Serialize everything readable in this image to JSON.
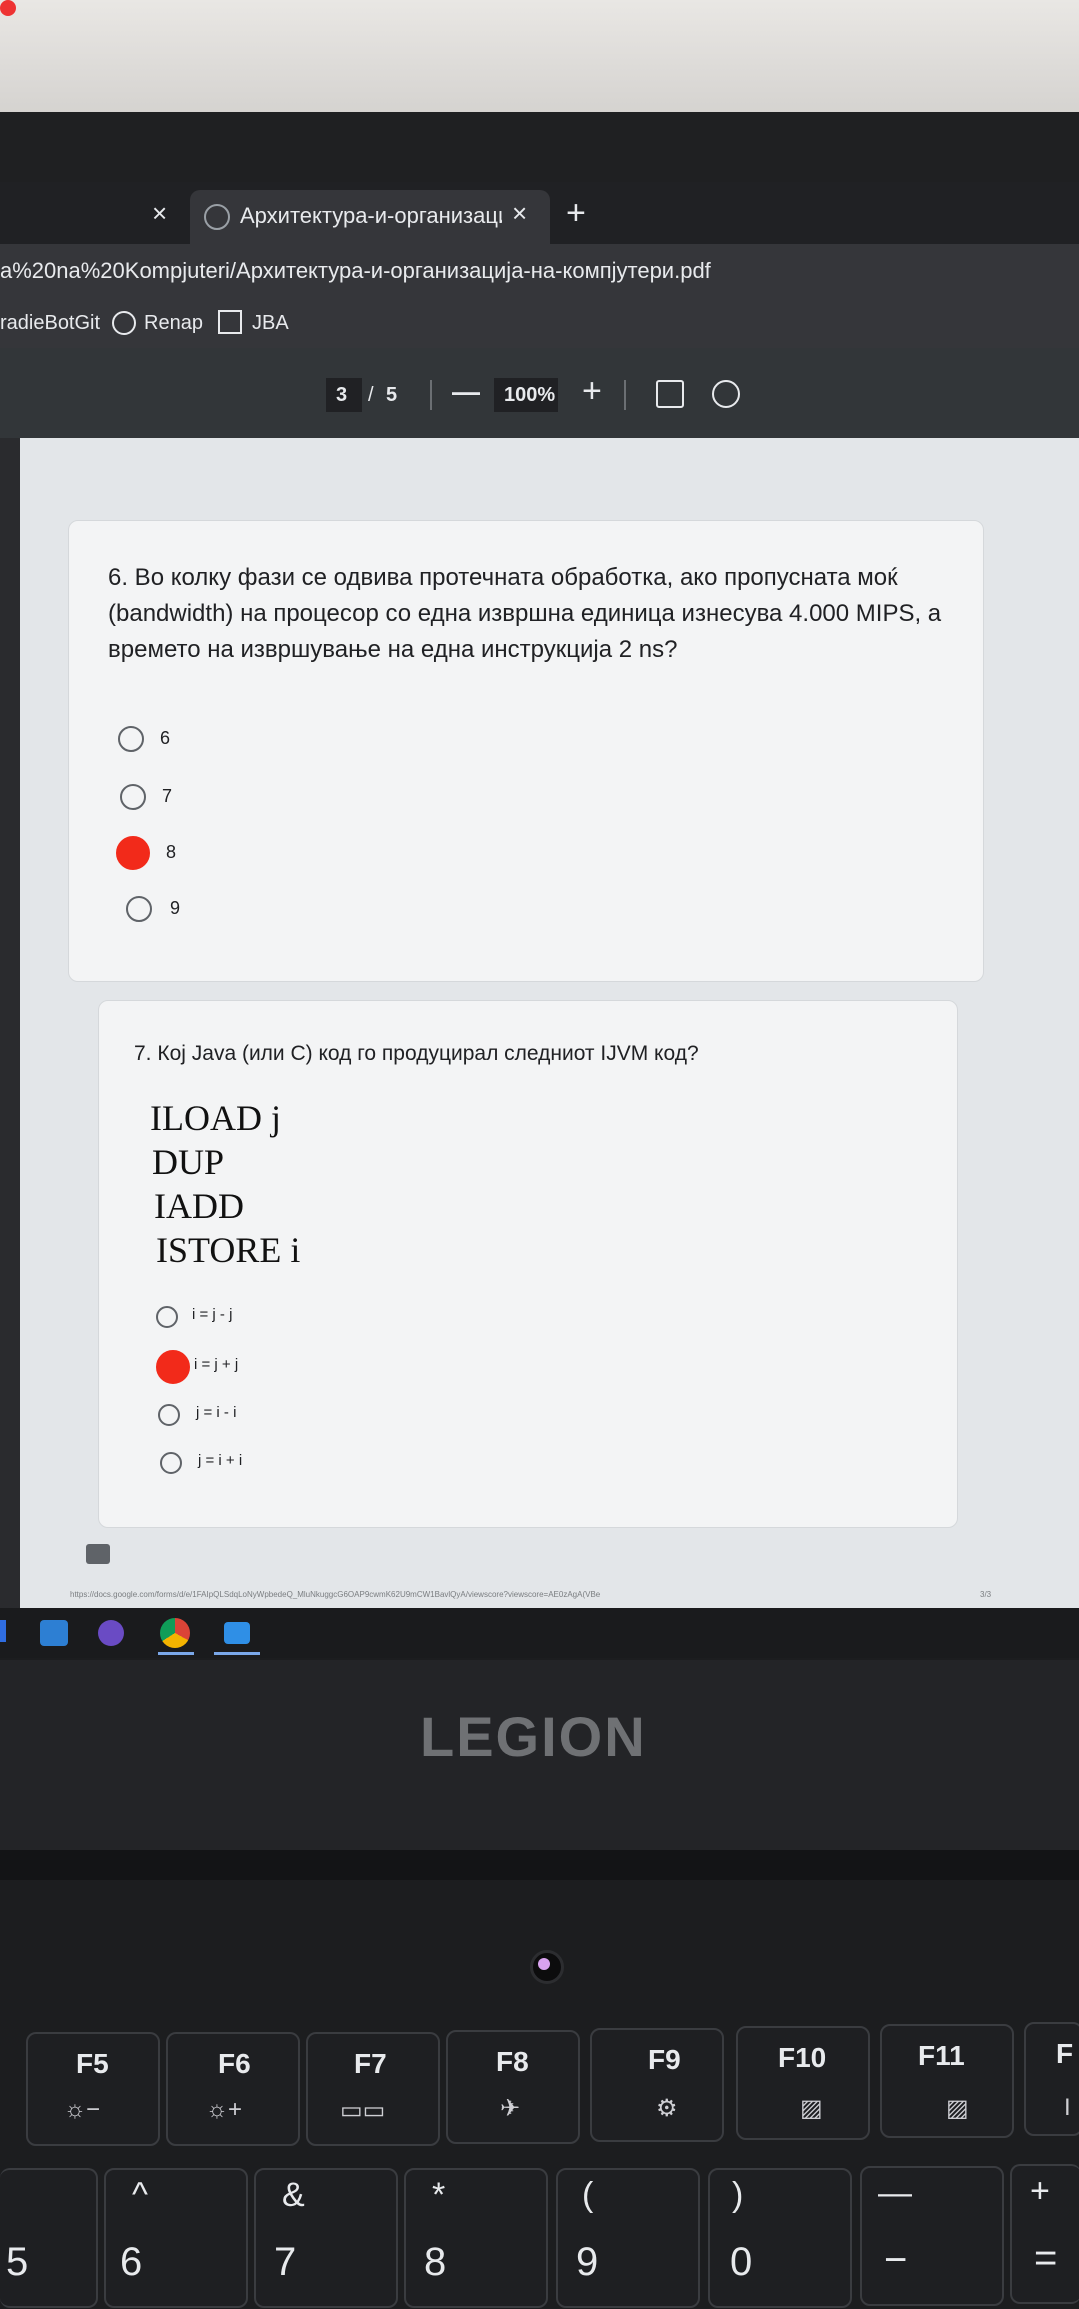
{
  "browser": {
    "tab_close_left": "×",
    "tab_title": "Архитектура-и-организација-н",
    "tab_close": "×",
    "new_tab": "+",
    "url": "a%20na%20Kompjuteri/Архитектура-и-организација-на-компјутери.pdf",
    "bookmarks": [
      {
        "label": "radieBotGit",
        "icon": ""
      },
      {
        "label": "Renap",
        "icon": "globe-icon"
      },
      {
        "label": "JBA",
        "icon": "bookmark-pen-icon"
      }
    ]
  },
  "pdf_toolbar": {
    "page_current": "3",
    "page_sep": "/",
    "page_total": "5",
    "zoom_out": "—",
    "zoom": "100%",
    "zoom_in": "+"
  },
  "questions": [
    {
      "text_lines": [
        "6. Во колку фази се одвива протечната обработка, ако пропусната моќ",
        "(bandwidth) на процесор со една извршна единица изнесува 4.000 MIPS, а",
        "времето на извршување на една инструкција 2 ns?"
      ],
      "options": [
        "6",
        "7",
        "8",
        "9"
      ],
      "selected_index": 2
    },
    {
      "text": "7. Кој Java (или C) код го продуцирал следниот IJVM код?",
      "code": [
        "ILOAD j",
        "DUP",
        "IADD",
        "ISTORE i"
      ],
      "options": [
        "i = j - j",
        "i = j + j",
        "j = i - i",
        "j = i + i"
      ],
      "selected_index": 1
    }
  ],
  "footer_url": "https://docs.google.com/forms/d/e/1FAIpQLSdqLoNyWpbedeQ_MluNkuggcG6OAP9cwmK62U9mCW1BavlQyA/viewscore?viewscore=AE0zAgA(VBe",
  "footer_page": "3/3",
  "laptop_brand": "LEGION",
  "keys_fn": [
    {
      "top": "F5",
      "bottom": "☼−"
    },
    {
      "top": "F6",
      "bottom": "☼+"
    },
    {
      "top": "F7",
      "bottom": "▭▭"
    },
    {
      "top": "F8",
      "bottom": "✈"
    },
    {
      "top": "F9",
      "bottom": "⚙"
    },
    {
      "top": "F10",
      "bottom": "▨"
    },
    {
      "top": "F11",
      "bottom": "▨"
    },
    {
      "top": "F",
      "bottom": "I"
    }
  ],
  "keys_num": [
    {
      "top": "",
      "bottom": "5"
    },
    {
      "top": "^",
      "bottom": "6"
    },
    {
      "top": "&",
      "bottom": "7"
    },
    {
      "top": "*",
      "bottom": "8"
    },
    {
      "top": "(",
      "bottom": "9"
    },
    {
      "top": ")",
      "bottom": "0"
    },
    {
      "top": "—",
      "bottom": "−"
    },
    {
      "top": "+",
      "bottom": "="
    }
  ]
}
